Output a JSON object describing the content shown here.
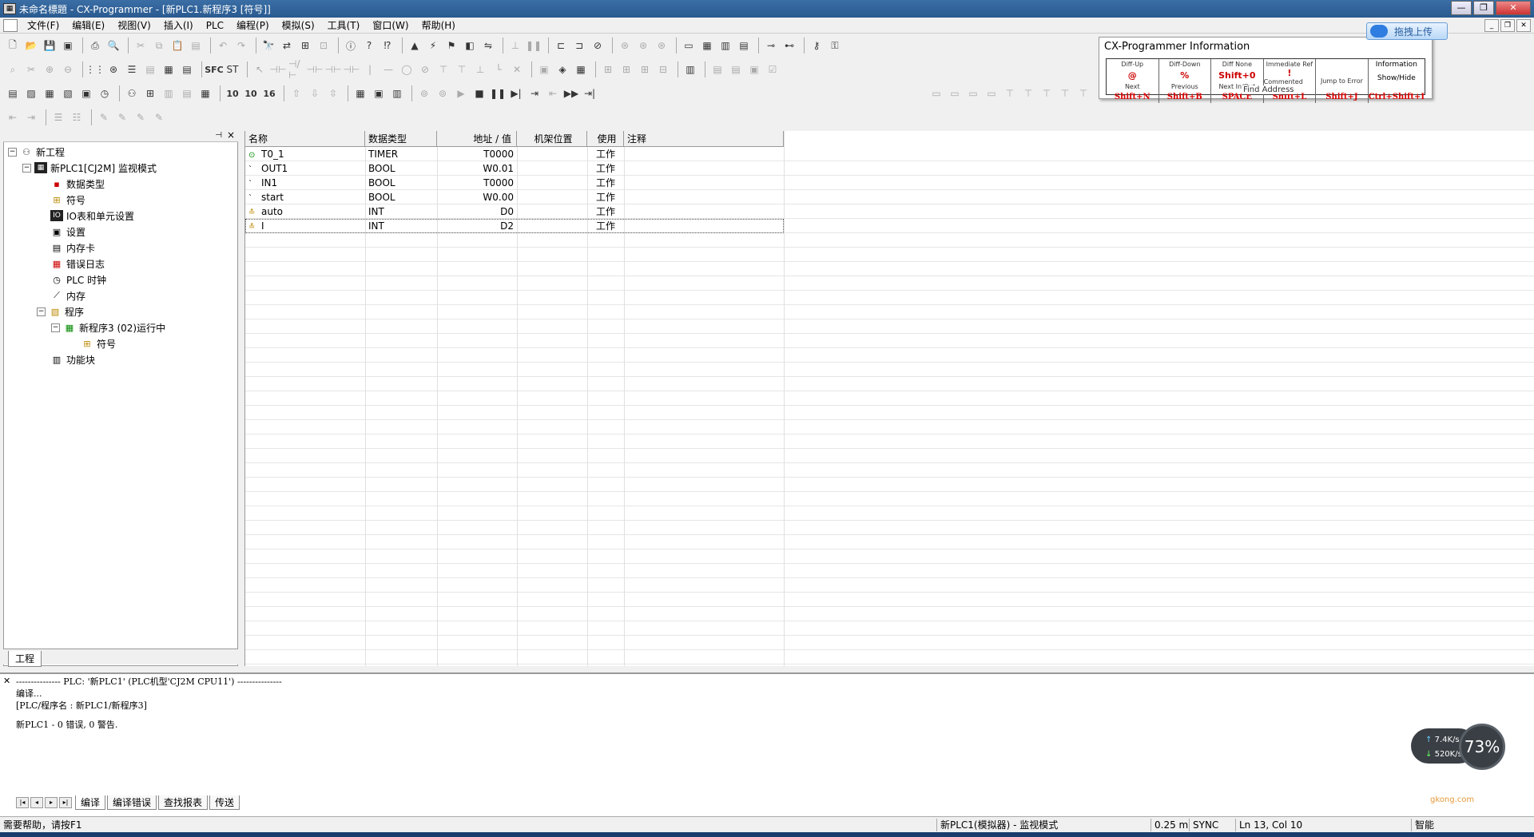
{
  "window": {
    "title": "未命名標題 - CX-Programmer - [新PLC1.新程序3 [符号]]",
    "controls": {
      "minimize": "—",
      "maximize": "❐",
      "close": "✕"
    }
  },
  "menu": {
    "items": [
      "文件(F)",
      "编辑(E)",
      "视图(V)",
      "插入(I)",
      "PLC",
      "编程(P)",
      "模拟(S)",
      "工具(T)",
      "窗口(W)",
      "帮助(H)"
    ]
  },
  "info_panel": {
    "title": "CX-Programmer Information",
    "cells": [
      {
        "label": "Diff-Up",
        "symbol": "@",
        "sub": "Next",
        "key": "Shift+N"
      },
      {
        "label": "Diff-Down",
        "symbol": "%",
        "sub": "Previous",
        "key": "Shift+B"
      },
      {
        "label": "Diff None",
        "symbol": "Shift+0",
        "sub": "Next In/Out",
        "key": "SPACE"
      },
      {
        "label": "Immediate Ref",
        "symbol": "!",
        "sub": "Commented Rung",
        "key": "Shift+L"
      },
      {
        "label": "",
        "symbol": "",
        "sub": "Jump to Error",
        "key": "Shift+J"
      },
      {
        "label": "Information",
        "symbol": "Show/Hide",
        "sub": "",
        "key": "Ctrl+Shift+I"
      }
    ],
    "overlay_text": "Find Address"
  },
  "upload_button": {
    "label": "拖拽上传"
  },
  "tree": {
    "tab": "工程",
    "nodes": [
      {
        "label": "新工程",
        "depth": 0,
        "expander": "−",
        "icon": "network-icon"
      },
      {
        "label": "新PLC1[CJ2M] 监视模式",
        "depth": 1,
        "expander": "−",
        "icon": "plc-icon"
      },
      {
        "label": "数据类型",
        "depth": 2,
        "expander": "",
        "icon": "datatype-icon"
      },
      {
        "label": "符号",
        "depth": 2,
        "expander": "",
        "icon": "symbols-icon"
      },
      {
        "label": "IO表和单元设置",
        "depth": 2,
        "expander": "",
        "icon": "io-table-icon"
      },
      {
        "label": "设置",
        "depth": 2,
        "expander": "",
        "icon": "settings-icon"
      },
      {
        "label": "内存卡",
        "depth": 2,
        "expander": "",
        "icon": "memory-card-icon"
      },
      {
        "label": "错误日志",
        "depth": 2,
        "expander": "",
        "icon": "error-log-icon"
      },
      {
        "label": "PLC 时钟",
        "depth": 2,
        "expander": "",
        "icon": "clock-icon"
      },
      {
        "label": "内存",
        "depth": 2,
        "expander": "",
        "icon": "memory-icon"
      },
      {
        "label": "程序",
        "depth": 2,
        "expander": "−",
        "icon": "programs-icon"
      },
      {
        "label": "新程序3 (02)运行中",
        "depth": 3,
        "expander": "−",
        "icon": "program-icon"
      },
      {
        "label": "符号",
        "depth": 4,
        "expander": "",
        "icon": "symbols-icon"
      },
      {
        "label": "功能块",
        "depth": 2,
        "expander": "",
        "icon": "function-block-icon"
      }
    ]
  },
  "symbols_table": {
    "columns": [
      "名称",
      "数据类型",
      "地址 / 值",
      "机架位置",
      "使用",
      "注释"
    ],
    "rows": [
      {
        "name": "T0_1",
        "type": "TIMER",
        "address": "T0000",
        "rack": "",
        "usage": "工作",
        "comment": "",
        "icon": "timer-icon"
      },
      {
        "name": "OUT1",
        "type": "BOOL",
        "address": "W0.01",
        "rack": "",
        "usage": "工作",
        "comment": "",
        "icon": "bool-icon"
      },
      {
        "name": "IN1",
        "type": "BOOL",
        "address": "T0000",
        "rack": "",
        "usage": "工作",
        "comment": "",
        "icon": "bool-icon"
      },
      {
        "name": "start",
        "type": "BOOL",
        "address": "W0.00",
        "rack": "",
        "usage": "工作",
        "comment": "",
        "icon": "bool-icon"
      },
      {
        "name": "auto",
        "type": "INT",
        "address": "D0",
        "rack": "",
        "usage": "工作",
        "comment": "",
        "icon": "int-icon"
      },
      {
        "name": "I",
        "type": "INT",
        "address": "D2",
        "rack": "",
        "usage": "工作",
        "comment": "",
        "icon": "int-icon"
      }
    ]
  },
  "output": {
    "lines": [
      "--------------- PLC: '新PLC1' (PLC机型'CJ2M CPU11') ---------------",
      "编译...",
      "[PLC/程序名 : 新PLC1/新程序3]",
      "",
      "新PLC1 - 0 错误, 0 警告."
    ],
    "tabs": [
      "编译",
      "编译错误",
      "查找报表",
      "传送"
    ]
  },
  "statusbar": {
    "help": "需要帮助，请按F1",
    "plc": "新PLC1(模拟器) - 监视模式",
    "cycle": "0.25 m",
    "sync": "SYNC",
    "position": "Ln 13, Col 10",
    "mode": "智能"
  },
  "net_widget": {
    "up": "7.4K/s",
    "down": "520K/s",
    "percent": "73%"
  },
  "watermark": "gkong.com"
}
